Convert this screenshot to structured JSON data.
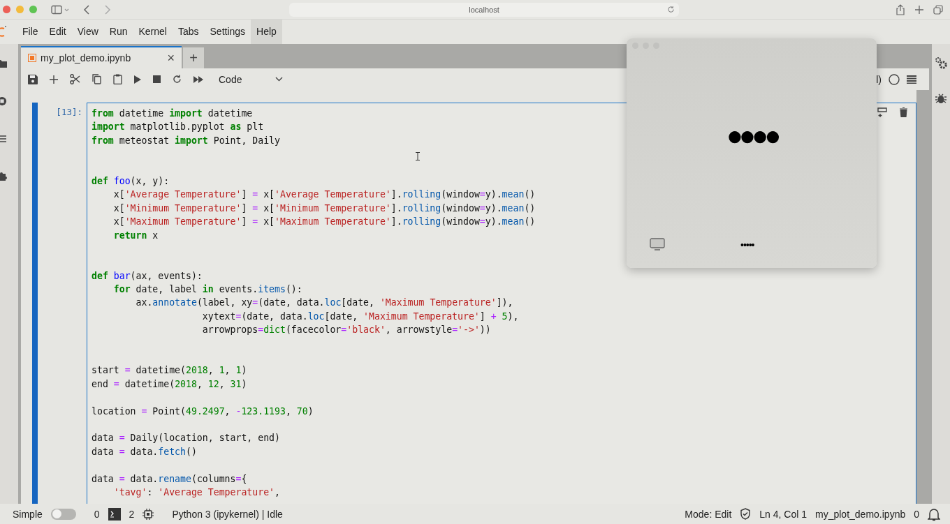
{
  "browser": {
    "url": "localhost"
  },
  "menu": [
    {
      "label": "File",
      "selected": false
    },
    {
      "label": "Edit",
      "selected": false
    },
    {
      "label": "View",
      "selected": false
    },
    {
      "label": "Run",
      "selected": false
    },
    {
      "label": "Kernel",
      "selected": false
    },
    {
      "label": "Tabs",
      "selected": false
    },
    {
      "label": "Settings",
      "selected": false
    },
    {
      "label": "Help",
      "selected": true
    }
  ],
  "tabs": [
    {
      "label": "my_plot_demo.ipynb",
      "close": "×",
      "selected": true
    }
  ],
  "new_tab": "+",
  "toolbar": {
    "cell_type": "Code",
    "kernel_fragment": "l)"
  },
  "cell": {
    "prompt": "[13]:",
    "active": true,
    "lines": [
      {
        "kind": "code",
        "tokens": [
          {
            "kind": "keyword",
            "text": "from"
          },
          {
            "kind": "plain",
            "text": " datetime "
          },
          {
            "kind": "keyword",
            "text": "import"
          },
          {
            "kind": "plain",
            "text": " datetime"
          }
        ]
      },
      {
        "kind": "code",
        "tokens": [
          {
            "kind": "keyword",
            "text": "import"
          },
          {
            "kind": "plain",
            "text": " matplotlib.pyplot "
          },
          {
            "kind": "keyword",
            "text": "as"
          },
          {
            "kind": "plain",
            "text": " plt"
          }
        ]
      },
      {
        "kind": "code",
        "tokens": [
          {
            "kind": "keyword",
            "text": "from"
          },
          {
            "kind": "plain",
            "text": " meteostat "
          },
          {
            "kind": "keyword",
            "text": "import"
          },
          {
            "kind": "plain",
            "text": " Point, Daily"
          }
        ]
      },
      {
        "kind": "blank"
      },
      {
        "kind": "blank"
      },
      {
        "kind": "code",
        "tokens": [
          {
            "kind": "keyword",
            "text": "def "
          },
          {
            "kind": "defname",
            "text": "foo"
          },
          {
            "kind": "plain",
            "text": "(x, y):"
          }
        ]
      },
      {
        "kind": "code",
        "tokens": [
          {
            "kind": "plain",
            "text": "    x["
          },
          {
            "kind": "string",
            "text": "'Average Temperature'"
          },
          {
            "kind": "plain",
            "text": "] "
          },
          {
            "kind": "operator",
            "text": "="
          },
          {
            "kind": "plain",
            "text": " x["
          },
          {
            "kind": "string",
            "text": "'Average Temperature'"
          },
          {
            "kind": "plain",
            "text": "]."
          },
          {
            "kind": "attr",
            "text": "rolling"
          },
          {
            "kind": "plain",
            "text": "(window"
          },
          {
            "kind": "operator",
            "text": "="
          },
          {
            "kind": "plain",
            "text": "y)."
          },
          {
            "kind": "attr",
            "text": "mean"
          },
          {
            "kind": "plain",
            "text": "()"
          }
        ]
      },
      {
        "kind": "code",
        "tokens": [
          {
            "kind": "plain",
            "text": "    x["
          },
          {
            "kind": "string",
            "text": "'Minimum Temperature'"
          },
          {
            "kind": "plain",
            "text": "] "
          },
          {
            "kind": "operator",
            "text": "="
          },
          {
            "kind": "plain",
            "text": " x["
          },
          {
            "kind": "string",
            "text": "'Minimum Temperature'"
          },
          {
            "kind": "plain",
            "text": "]."
          },
          {
            "kind": "attr",
            "text": "rolling"
          },
          {
            "kind": "plain",
            "text": "(window"
          },
          {
            "kind": "operator",
            "text": "="
          },
          {
            "kind": "plain",
            "text": "y)."
          },
          {
            "kind": "attr",
            "text": "mean"
          },
          {
            "kind": "plain",
            "text": "()"
          }
        ]
      },
      {
        "kind": "code",
        "tokens": [
          {
            "kind": "plain",
            "text": "    x["
          },
          {
            "kind": "string",
            "text": "'Maximum Temperature'"
          },
          {
            "kind": "plain",
            "text": "] "
          },
          {
            "kind": "operator",
            "text": "="
          },
          {
            "kind": "plain",
            "text": " x["
          },
          {
            "kind": "string",
            "text": "'Maximum Temperature'"
          },
          {
            "kind": "plain",
            "text": "]."
          },
          {
            "kind": "attr",
            "text": "rolling"
          },
          {
            "kind": "plain",
            "text": "(window"
          },
          {
            "kind": "operator",
            "text": "="
          },
          {
            "kind": "plain",
            "text": "y)."
          },
          {
            "kind": "attr",
            "text": "mean"
          },
          {
            "kind": "plain",
            "text": "()"
          }
        ]
      },
      {
        "kind": "code",
        "tokens": [
          {
            "kind": "keyword",
            "text": "    return"
          },
          {
            "kind": "plain",
            "text": " x"
          }
        ]
      },
      {
        "kind": "blank"
      },
      {
        "kind": "blank"
      },
      {
        "kind": "code",
        "tokens": [
          {
            "kind": "keyword",
            "text": "def "
          },
          {
            "kind": "defname",
            "text": "bar"
          },
          {
            "kind": "plain",
            "text": "(ax, events):"
          }
        ]
      },
      {
        "kind": "code",
        "tokens": [
          {
            "kind": "keyword",
            "text": "    for"
          },
          {
            "kind": "plain",
            "text": " date, label "
          },
          {
            "kind": "keyword",
            "text": "in"
          },
          {
            "kind": "plain",
            "text": " events."
          },
          {
            "kind": "attr",
            "text": "items"
          },
          {
            "kind": "plain",
            "text": "():"
          }
        ]
      },
      {
        "kind": "code",
        "tokens": [
          {
            "kind": "plain",
            "text": "        ax."
          },
          {
            "kind": "attr",
            "text": "annotate"
          },
          {
            "kind": "plain",
            "text": "(label, xy"
          },
          {
            "kind": "operator",
            "text": "="
          },
          {
            "kind": "plain",
            "text": "(date, data."
          },
          {
            "kind": "attr",
            "text": "loc"
          },
          {
            "kind": "plain",
            "text": "[date, "
          },
          {
            "kind": "string",
            "text": "'Maximum Temperature'"
          },
          {
            "kind": "plain",
            "text": "]),"
          }
        ]
      },
      {
        "kind": "code",
        "tokens": [
          {
            "kind": "plain",
            "text": "                    xytext"
          },
          {
            "kind": "operator",
            "text": "="
          },
          {
            "kind": "plain",
            "text": "(date, data."
          },
          {
            "kind": "attr",
            "text": "loc"
          },
          {
            "kind": "plain",
            "text": "[date, "
          },
          {
            "kind": "string",
            "text": "'Maximum Temperature'"
          },
          {
            "kind": "plain",
            "text": "] "
          },
          {
            "kind": "operator",
            "text": "+ "
          },
          {
            "kind": "number",
            "text": "5"
          },
          {
            "kind": "plain",
            "text": "),"
          }
        ]
      },
      {
        "kind": "code",
        "tokens": [
          {
            "kind": "plain",
            "text": "                    arrowprops"
          },
          {
            "kind": "operator",
            "text": "="
          },
          {
            "kind": "builtin",
            "text": "dict"
          },
          {
            "kind": "plain",
            "text": "(facecolor"
          },
          {
            "kind": "operator",
            "text": "="
          },
          {
            "kind": "string",
            "text": "'black'"
          },
          {
            "kind": "plain",
            "text": ", arrowstyle"
          },
          {
            "kind": "operator",
            "text": "="
          },
          {
            "kind": "string",
            "text": "'->'"
          },
          {
            "kind": "plain",
            "text": "))"
          }
        ]
      },
      {
        "kind": "blank"
      },
      {
        "kind": "blank"
      },
      {
        "kind": "code",
        "tokens": [
          {
            "kind": "plain",
            "text": "start "
          },
          {
            "kind": "operator",
            "text": "="
          },
          {
            "kind": "plain",
            "text": " datetime("
          },
          {
            "kind": "number",
            "text": "2018"
          },
          {
            "kind": "plain",
            "text": ", "
          },
          {
            "kind": "number",
            "text": "1"
          },
          {
            "kind": "plain",
            "text": ", "
          },
          {
            "kind": "number",
            "text": "1"
          },
          {
            "kind": "plain",
            "text": ")"
          }
        ]
      },
      {
        "kind": "code",
        "tokens": [
          {
            "kind": "plain",
            "text": "end "
          },
          {
            "kind": "operator",
            "text": "="
          },
          {
            "kind": "plain",
            "text": " datetime("
          },
          {
            "kind": "number",
            "text": "2018"
          },
          {
            "kind": "plain",
            "text": ", "
          },
          {
            "kind": "number",
            "text": "12"
          },
          {
            "kind": "plain",
            "text": ", "
          },
          {
            "kind": "number",
            "text": "31"
          },
          {
            "kind": "plain",
            "text": ")"
          }
        ]
      },
      {
        "kind": "blank"
      },
      {
        "kind": "code",
        "tokens": [
          {
            "kind": "plain",
            "text": "location "
          },
          {
            "kind": "operator",
            "text": "="
          },
          {
            "kind": "plain",
            "text": " Point("
          },
          {
            "kind": "number",
            "text": "49.2497"
          },
          {
            "kind": "plain",
            "text": ", "
          },
          {
            "kind": "operator",
            "text": "-"
          },
          {
            "kind": "number",
            "text": "123.1193"
          },
          {
            "kind": "plain",
            "text": ", "
          },
          {
            "kind": "number",
            "text": "70"
          },
          {
            "kind": "plain",
            "text": ")"
          }
        ]
      },
      {
        "kind": "blank"
      },
      {
        "kind": "code",
        "tokens": [
          {
            "kind": "plain",
            "text": "data "
          },
          {
            "kind": "operator",
            "text": "="
          },
          {
            "kind": "plain",
            "text": " Daily(location, start, end)"
          }
        ]
      },
      {
        "kind": "code",
        "tokens": [
          {
            "kind": "plain",
            "text": "data "
          },
          {
            "kind": "operator",
            "text": "="
          },
          {
            "kind": "plain",
            "text": " data."
          },
          {
            "kind": "attr",
            "text": "fetch"
          },
          {
            "kind": "plain",
            "text": "()"
          }
        ]
      },
      {
        "kind": "blank"
      },
      {
        "kind": "code",
        "tokens": [
          {
            "kind": "plain",
            "text": "data "
          },
          {
            "kind": "operator",
            "text": "="
          },
          {
            "kind": "plain",
            "text": " data."
          },
          {
            "kind": "attr",
            "text": "rename"
          },
          {
            "kind": "plain",
            "text": "(columns"
          },
          {
            "kind": "operator",
            "text": "="
          },
          {
            "kind": "plain",
            "text": "{"
          }
        ]
      },
      {
        "kind": "code",
        "tokens": [
          {
            "kind": "string",
            "text": "    'tavg'"
          },
          {
            "kind": "plain",
            "text": ": "
          },
          {
            "kind": "string",
            "text": "'Average Temperature'"
          },
          {
            "kind": "plain",
            "text": ","
          }
        ]
      }
    ]
  },
  "popup": {
    "password_mask": "●●●●",
    "dots": "•••••"
  },
  "status_bar": {
    "mode_label": "Simple",
    "simple_on": false,
    "terminals": "0",
    "kernels": "2",
    "kernel_status": "Python 3 (ipykernel) | Idle",
    "mode": "Mode: Edit",
    "cursor": "Ln 4, Col 1",
    "file": "my_plot_demo.ipynb",
    "notifications": "0"
  }
}
